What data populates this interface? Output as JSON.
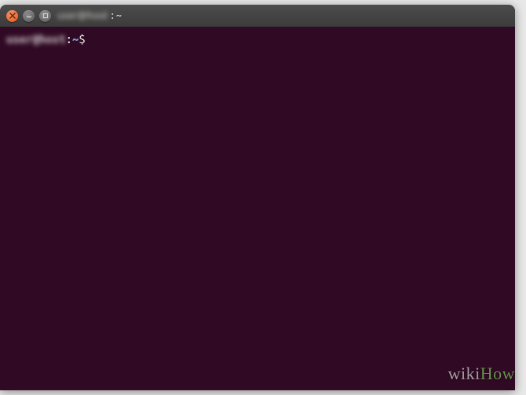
{
  "titlebar": {
    "obscured_user": "user@host",
    "suffix": ": ~"
  },
  "prompt": {
    "obscured_user": "user@host",
    "path": "~",
    "symbol": "$"
  },
  "watermark": {
    "wiki": "wiki",
    "how": "How"
  },
  "colors": {
    "terminal_bg": "#300a24",
    "titlebar_bg": "#3c3c3c",
    "close_btn": "#e95420",
    "text": "#eeeeec",
    "path": "#729fcf"
  }
}
